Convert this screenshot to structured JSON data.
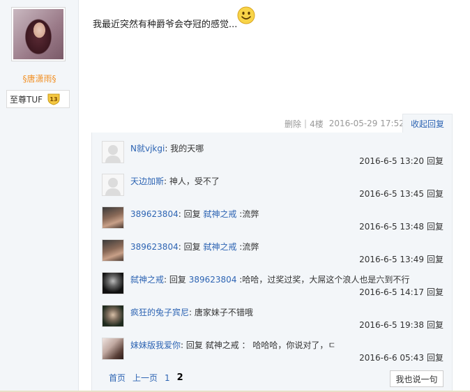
{
  "author": {
    "name": "§唐潇雨§",
    "rank_label": "至尊TUF",
    "rank_level": "13"
  },
  "post": {
    "text": "我最近突然有种爵爷会夺冠的感觉..."
  },
  "meta": {
    "delete_label": "删除",
    "separator": "|",
    "floor": "4楼",
    "datetime": "2016-05-29 17:52",
    "collapse_label": "收起回复"
  },
  "replies": [
    {
      "nick": "N就vjkgi",
      "colon": ":",
      "prefix": "",
      "reply_to": "",
      "content": "我的天哪",
      "time": "2016-6-5 13:20",
      "reply_label": "回复"
    },
    {
      "nick": "天边加斯",
      "colon": ":",
      "prefix": "",
      "reply_to": "",
      "content": "神人，受不了",
      "time": "2016-6-5 13:45",
      "reply_label": "回复"
    },
    {
      "nick": "389623804",
      "colon": ":",
      "prefix": "回复",
      "reply_to": "弑神之戒",
      "content": ":流弊",
      "time": "2016-6-5 13:48",
      "reply_label": "回复"
    },
    {
      "nick": "389623804",
      "colon": ":",
      "prefix": "回复",
      "reply_to": "弑神之戒",
      "content": ":流弊",
      "time": "2016-6-5 13:49",
      "reply_label": "回复"
    },
    {
      "nick": "弑神之戒",
      "colon": ":",
      "prefix": "回复",
      "reply_to": "389623804",
      "content": ":哈哈，过奖过奖，大屌这个浪人也是六到不行",
      "time": "2016-6-5 14:17",
      "reply_label": "回复"
    },
    {
      "nick": "疯狂的兔子宾尼",
      "colon": ":",
      "prefix": "",
      "reply_to": "",
      "content": "唐家妹子不错哦",
      "time": "2016-6-5 19:38",
      "reply_label": "回复"
    },
    {
      "nick": "妹妹版我爱你",
      "colon": ":",
      "prefix": "回复 弑神之戒 ：",
      "reply_to": "",
      "content": "哈哈哈，你说对了，ㄷ",
      "time": "2016-6-6 05:43",
      "reply_label": "回复"
    }
  ],
  "pager": {
    "first": "首页",
    "prev": "上一页",
    "page1": "1",
    "page2": "2"
  },
  "say_button": "我也说一句",
  "colors": {
    "link": "#2d64b3",
    "username": "#f29126",
    "panel_bg": "#f3f6f9"
  }
}
